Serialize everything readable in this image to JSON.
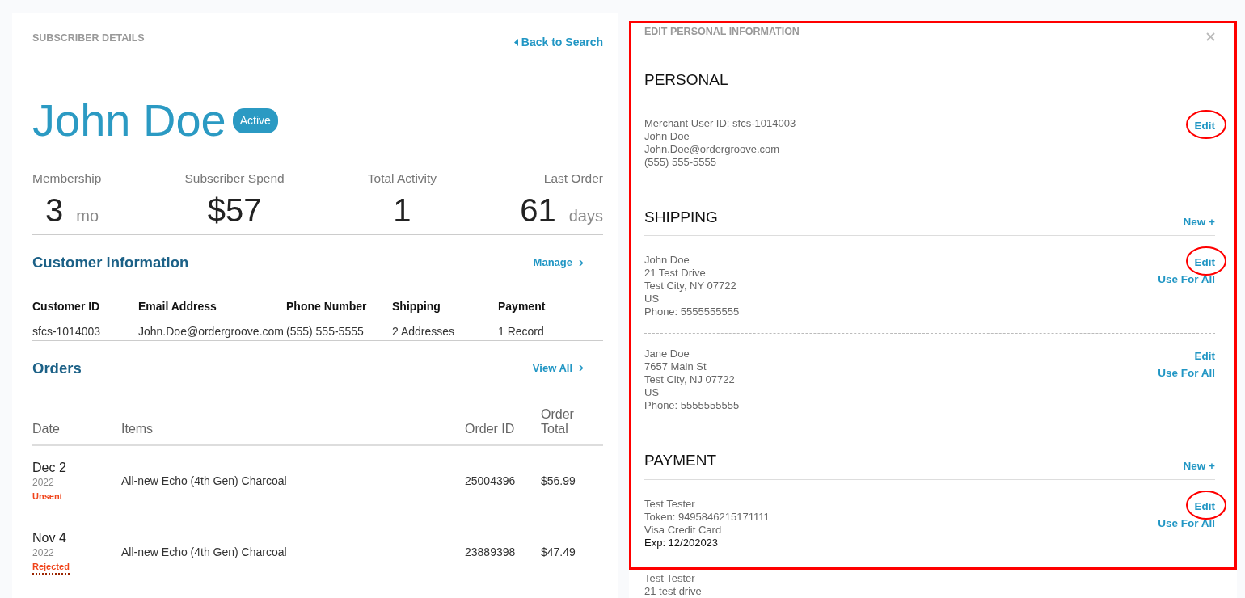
{
  "header": {
    "title": "SUBSCRIBER DETAILS",
    "back_link": "Back to Search"
  },
  "subscriber": {
    "name": "John Doe",
    "status": "Active"
  },
  "stats": [
    {
      "label": "Membership",
      "value": "3",
      "unit": "mo"
    },
    {
      "label": "Subscriber Spend",
      "value": "$57"
    },
    {
      "label": "Total Activity",
      "value": "1"
    },
    {
      "label": "Last Order",
      "value": "61",
      "unit": "days"
    }
  ],
  "customer_info": {
    "title": "Customer information",
    "action": "Manage",
    "columns": [
      "Customer ID",
      "Email Address",
      "Phone Number",
      "Shipping",
      "Payment"
    ],
    "values": [
      "sfcs-1014003",
      "John.Doe@ordergroove.com",
      "(555) 555-5555",
      "2 Addresses",
      "1 Record"
    ]
  },
  "orders": {
    "title": "Orders",
    "action": "View All",
    "columns": [
      "Date",
      "Items",
      "Order ID",
      "Order Total"
    ],
    "rows": [
      {
        "date": "Dec 2",
        "year": "2022",
        "status": "Unsent",
        "underlined": false,
        "items": "All-new Echo (4th Gen) Charcoal",
        "order_id": "25004396",
        "total": "$56.99"
      },
      {
        "date": "Nov 4",
        "year": "2022",
        "status": "Rejected",
        "underlined": true,
        "items": "All-new Echo (4th Gen) Charcoal",
        "order_id": "23889398",
        "total": "$47.49"
      }
    ]
  },
  "panel": {
    "title": "EDIT PERSONAL INFORMATION",
    "highlighted": true,
    "sections": [
      {
        "title": "PERSONAL",
        "entries": [
          {
            "lines": [
              "Merchant User ID: sfcs-1014003",
              "John Doe",
              "John.Doe@ordergroove.com",
              "(555) 555-5555"
            ],
            "actions": [
              {
                "label": "Edit",
                "circled": true
              }
            ]
          }
        ]
      },
      {
        "title": "SHIPPING",
        "new_action": "New +",
        "entries": [
          {
            "lines": [
              "John Doe",
              "21 Test Drive",
              "Test City, NY 07722",
              "US",
              "Phone: 5555555555"
            ],
            "actions": [
              {
                "label": "Edit",
                "circled": true
              },
              {
                "label": "Use For All",
                "circled": false
              }
            ]
          },
          {
            "separated": true,
            "lines": [
              "Jane Doe",
              "7657 Main St",
              "Test City, NJ 07722",
              "US",
              "Phone: 5555555555"
            ],
            "actions": [
              {
                "label": "Edit",
                "circled": false
              },
              {
                "label": "Use For All",
                "circled": false
              }
            ]
          }
        ]
      },
      {
        "title": "PAYMENT",
        "new_action": "New +",
        "entries": [
          {
            "lines": [
              "Test Tester",
              "Token: 9495846215171111",
              "Visa Credit Card"
            ],
            "expiry": "Exp: 12/202023",
            "actions": [
              {
                "label": "Edit",
                "circled": true
              },
              {
                "label": "Use For All",
                "circled": false
              }
            ]
          },
          {
            "lines": [
              "Test Tester",
              "21 test drive"
            ]
          }
        ]
      }
    ]
  }
}
